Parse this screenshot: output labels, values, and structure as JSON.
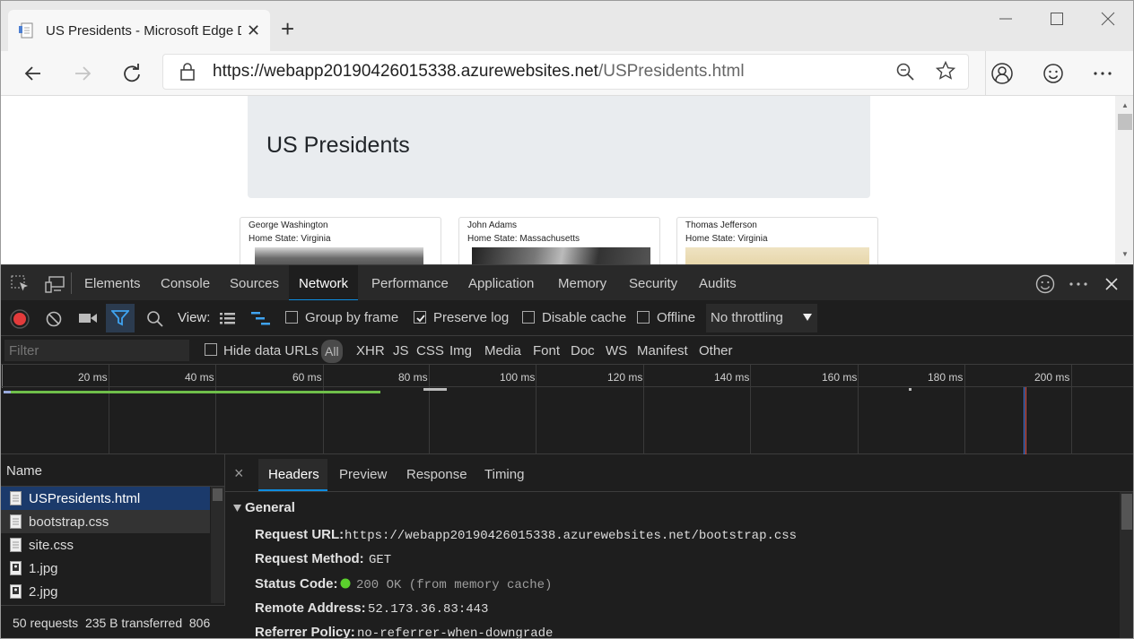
{
  "browser": {
    "tab_title": "US Presidents - Microsoft Edge D",
    "new_tab_symbol": "+",
    "url_host": "https://webapp20190426015338.azurewebsites.net",
    "url_path": "/USPresidents.html"
  },
  "page": {
    "heading": "US Presidents",
    "cards": [
      {
        "name": "George Washington",
        "state": "Home State: Virginia"
      },
      {
        "name": "John Adams",
        "state": "Home State: Massachusetts"
      },
      {
        "name": "Thomas Jefferson",
        "state": "Home State: Virginia"
      }
    ]
  },
  "devtools": {
    "tabs": [
      "Elements",
      "Console",
      "Sources",
      "Network",
      "Performance",
      "Application",
      "Memory",
      "Security",
      "Audits"
    ],
    "active_tab": "Network",
    "toolbar": {
      "view_label": "View:",
      "group_by_frame": "Group by frame",
      "preserve_log": "Preserve log",
      "disable_cache": "Disable cache",
      "offline": "Offline",
      "throttling": "No throttling"
    },
    "filter": {
      "placeholder": "Filter",
      "hide_data_urls": "Hide data URLs",
      "types": [
        "All",
        "XHR",
        "JS",
        "CSS",
        "Img",
        "Media",
        "Font",
        "Doc",
        "WS",
        "Manifest",
        "Other"
      ]
    },
    "timeline_ticks": [
      "20 ms",
      "40 ms",
      "60 ms",
      "80 ms",
      "100 ms",
      "120 ms",
      "140 ms",
      "160 ms",
      "180 ms",
      "200 ms"
    ],
    "requests": {
      "header": "Name",
      "items": [
        "USPresidents.html",
        "bootstrap.css",
        "site.css",
        "1.jpg",
        "2.jpg"
      ]
    },
    "status": "50 requests  235 B transferred  806",
    "detail": {
      "close": "×",
      "tabs": [
        "Headers",
        "Preview",
        "Response",
        "Timing"
      ],
      "section": "General",
      "headers": [
        {
          "key": "Request URL:",
          "value": "https://webapp20190426015338.azurewebsites.net/bootstrap.css"
        },
        {
          "key": "Request Method:",
          "value": "GET"
        },
        {
          "key": "Status Code:",
          "value": "200 OK (from memory cache)"
        },
        {
          "key": "Remote Address:",
          "value": "52.173.36.83:443"
        },
        {
          "key": "Referrer Policy:",
          "value": "no-referrer-when-downgrade"
        }
      ]
    }
  },
  "colors": {
    "accent": "#0e8de0",
    "record": "#e23b3b",
    "status_ok": "#5bd02d"
  }
}
